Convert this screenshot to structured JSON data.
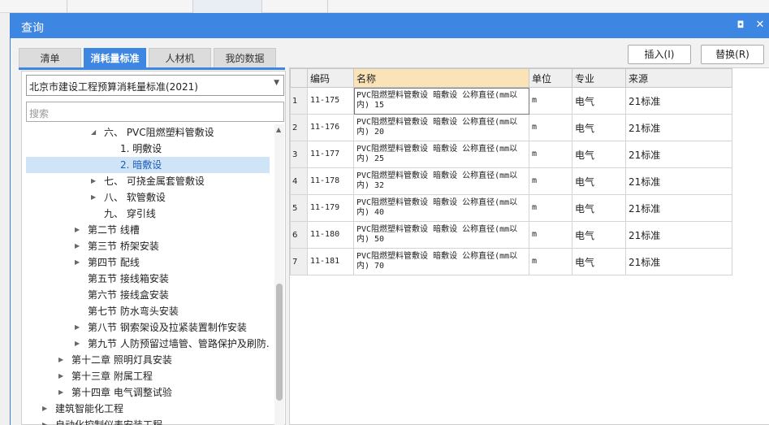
{
  "window": {
    "title": "查询",
    "restore_glyph": "◘",
    "close_glyph": "✕"
  },
  "tabs": [
    {
      "label": "清单",
      "active": false
    },
    {
      "label": "消耗量标准",
      "active": true
    },
    {
      "label": "人材机",
      "active": false
    },
    {
      "label": "我的数据",
      "active": false
    }
  ],
  "actions": {
    "insert_label": "插入(I)",
    "replace_label": "替换(R)"
  },
  "left": {
    "standard_selected": "北京市建设工程预算消耗量标准(2021)",
    "search_placeholder": "搜索",
    "tree": [
      {
        "label": "六、 PVC阻燃塑料管敷设",
        "level": 3,
        "expander": "expanded"
      },
      {
        "label": "1. 明敷设",
        "level": 4,
        "expander": "none"
      },
      {
        "label": "2. 暗敷设",
        "level": 4,
        "expander": "none",
        "selected": true
      },
      {
        "label": "七、 可挠金属套管敷设",
        "level": 3,
        "expander": "collapsed"
      },
      {
        "label": "八、 软管敷设",
        "level": 3,
        "expander": "collapsed"
      },
      {
        "label": "九、 穿引线",
        "level": 3,
        "expander": "none"
      },
      {
        "label": "第二节 线槽",
        "level": 2,
        "expander": "collapsed"
      },
      {
        "label": "第三节 桥架安装",
        "level": 2,
        "expander": "collapsed"
      },
      {
        "label": "第四节 配线",
        "level": 2,
        "expander": "collapsed"
      },
      {
        "label": "第五节 接线箱安装",
        "level": 2,
        "expander": "none"
      },
      {
        "label": "第六节 接线盒安装",
        "level": 2,
        "expander": "none"
      },
      {
        "label": "第七节 防水弯头安装",
        "level": 2,
        "expander": "none"
      },
      {
        "label": "第八节 钢索架设及拉紧装置制作安装",
        "level": 2,
        "expander": "collapsed"
      },
      {
        "label": "第九节 人防预留过墙管、管路保护及刷防...",
        "level": 2,
        "expander": "collapsed"
      },
      {
        "label": "第十二章 照明灯具安装",
        "level": 1,
        "expander": "collapsed"
      },
      {
        "label": "第十三章 附属工程",
        "level": 1,
        "expander": "collapsed"
      },
      {
        "label": "第十四章 电气调整试验",
        "level": 1,
        "expander": "collapsed"
      },
      {
        "label": "建筑智能化工程",
        "level": 0,
        "expander": "collapsed"
      },
      {
        "label": "自动化控制仪表安装工程",
        "level": 0,
        "expander": "collapsed"
      }
    ]
  },
  "table": {
    "headers": [
      "",
      "编码",
      "名称",
      "单位",
      "专业",
      "来源"
    ],
    "rows": [
      {
        "idx": "1",
        "code": "11-175",
        "name": "PVC阻燃塑料管敷设 暗敷设 公称直径(mm以内) 15",
        "unit": "m",
        "major": "电气",
        "source": "21标准"
      },
      {
        "idx": "2",
        "code": "11-176",
        "name": "PVC阻燃塑料管敷设 暗敷设 公称直径(mm以内) 20",
        "unit": "m",
        "major": "电气",
        "source": "21标准"
      },
      {
        "idx": "3",
        "code": "11-177",
        "name": "PVC阻燃塑料管敷设 暗敷设 公称直径(mm以内) 25",
        "unit": "m",
        "major": "电气",
        "source": "21标准"
      },
      {
        "idx": "4",
        "code": "11-178",
        "name": "PVC阻燃塑料管敷设 暗敷设 公称直径(mm以内) 32",
        "unit": "m",
        "major": "电气",
        "source": "21标准"
      },
      {
        "idx": "5",
        "code": "11-179",
        "name": "PVC阻燃塑料管敷设 暗敷设 公称直径(mm以内) 40",
        "unit": "m",
        "major": "电气",
        "source": "21标准"
      },
      {
        "idx": "6",
        "code": "11-180",
        "name": "PVC阻燃塑料管敷设 暗敷设 公称直径(mm以内) 50",
        "unit": "m",
        "major": "电气",
        "source": "21标准"
      },
      {
        "idx": "7",
        "code": "11-181",
        "name": "PVC阻燃塑料管敷设 暗敷设 公称直径(mm以内) 70",
        "unit": "m",
        "major": "电气",
        "source": "21标准"
      }
    ]
  },
  "colors": {
    "accent": "#3d86e1",
    "selected_bg": "#cfe4f7",
    "sorted_header": "#fbe3b8"
  }
}
